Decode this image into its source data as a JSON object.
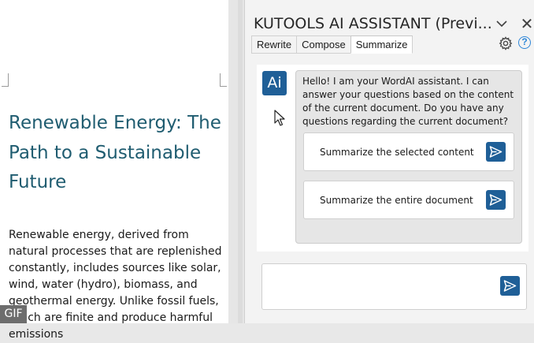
{
  "document": {
    "title": "Renewable Energy: The Path to a Sustainable Future",
    "body": "Renewable energy, derived from natural processes that are replenished constantly, includes sources like solar, wind, water (hydro), biomass, and geothermal energy. Unlike fossil fuels, which are finite and produce harmful emissions"
  },
  "badge": {
    "label": "GIF"
  },
  "panel": {
    "title": "KUTOOLS AI ASSISTANT (Previ...",
    "tabs": [
      {
        "label": "Rewrite"
      },
      {
        "label": "Compose"
      },
      {
        "label": "Summarize",
        "active": true
      }
    ],
    "icons": [
      "chevron-down-icon",
      "close-icon",
      "gear-icon",
      "help-icon",
      "send-icon"
    ],
    "help_glyph": "?",
    "close_glyph": "✕",
    "avatar_label": "Ai",
    "greeting": "Hello! I am your WordAI assistant. I can answer your questions based on the content of the current document. Do you have any questions regarding the current document?",
    "suggestions": [
      {
        "label": "Summarize the selected content"
      },
      {
        "label": "Summarize the entire document"
      }
    ],
    "input": {
      "value": "",
      "placeholder": ""
    }
  },
  "colors": {
    "accent": "#1f5f97",
    "title_teal": "#1f5c70",
    "help_blue": "#2f87d8"
  }
}
